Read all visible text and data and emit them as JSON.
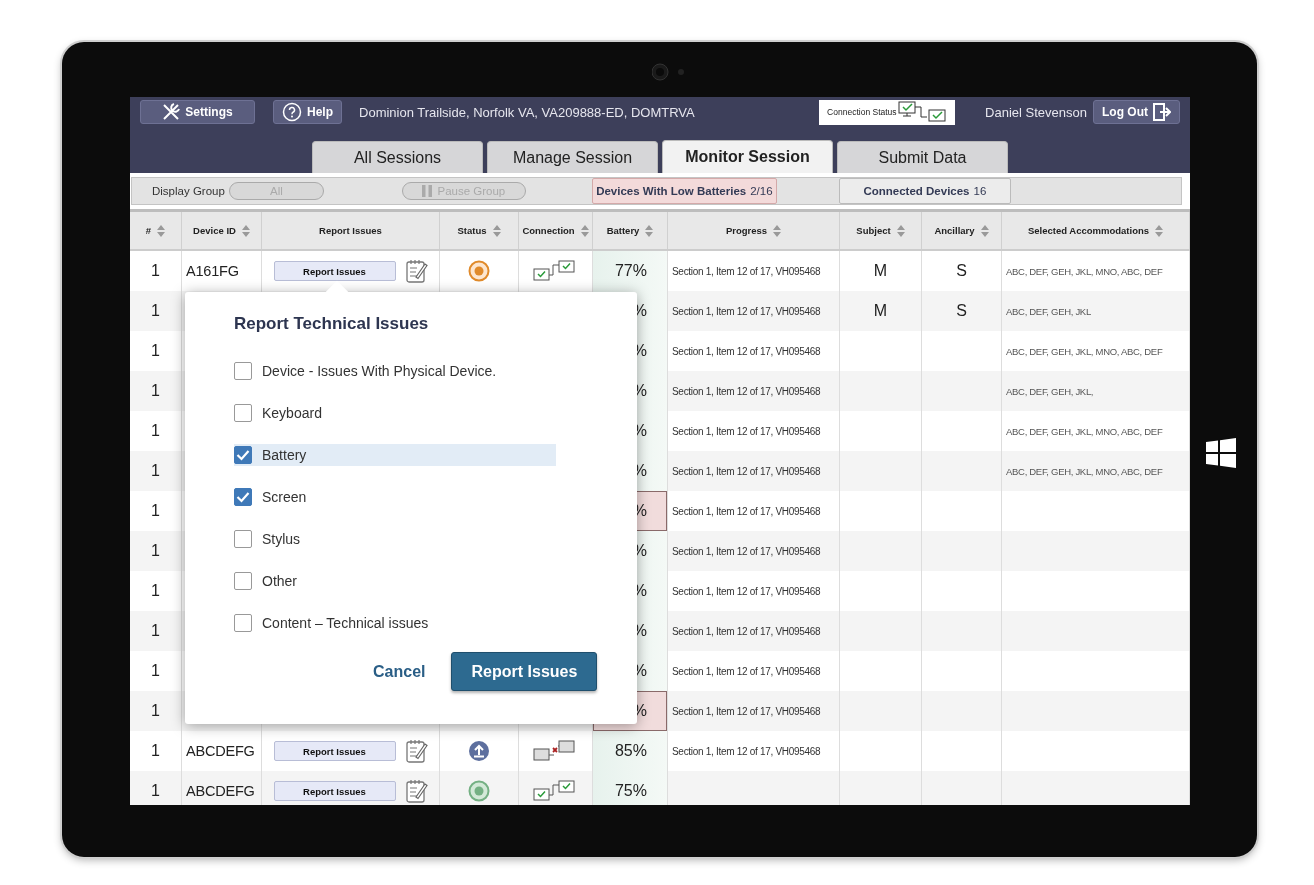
{
  "header": {
    "settings_button": "Settings",
    "help_button": "Help",
    "location": "Dominion Trailside, Norfolk VA, VA209888-ED, DOMTRVA",
    "connection_status": "Connection Status",
    "user": "Daniel Stevenson",
    "logout_button": "Log Out"
  },
  "tabs": [
    {
      "label": "All Sessions",
      "selected": false
    },
    {
      "label": "Manage Session",
      "selected": false
    },
    {
      "label": "Monitor Session",
      "selected": true
    },
    {
      "label": "Submit Data",
      "selected": false
    }
  ],
  "toolbar": {
    "display_group_label": "Display Group",
    "all_button": {
      "label": "All",
      "disabled": true
    },
    "pause_button": {
      "label": "Pause Group",
      "disabled": true
    },
    "low_batteries": {
      "label": "Devices With Low Batteries",
      "count": "2/16"
    },
    "connected": {
      "label": "Connected Devices",
      "count": "16"
    }
  },
  "columns": [
    {
      "label": "#",
      "sortable": true
    },
    {
      "label": "Device ID",
      "sortable": true
    },
    {
      "label": "Report Issues",
      "sortable": false
    },
    {
      "label": "Status",
      "sortable": true
    },
    {
      "label": "Connection",
      "sortable": true
    },
    {
      "label": "Battery",
      "sortable": true
    },
    {
      "label": "Progress",
      "sortable": true
    },
    {
      "label": "Subject",
      "sortable": true
    },
    {
      "label": "Ancillary",
      "sortable": true
    },
    {
      "label": "Selected Accommodations",
      "sortable": true
    }
  ],
  "rows": [
    {
      "number": "1",
      "device_id": "A161FG",
      "report_button": "Report Issues",
      "status": {
        "kind": "pending"
      },
      "connection": {
        "kind": "connected"
      },
      "battery": "77%",
      "battery_low": false,
      "progress": "Section 1, Item 12 of 17, VH095468",
      "subject": "M",
      "ancillary": "S",
      "accommodations": "ABC, DEF, GEH, JKL, MNO, ABC, DEF"
    },
    {
      "number": "1",
      "battery": "%",
      "battery_low": false,
      "progress": "Section 1, Item 12 of 17, VH095468",
      "subject": "M",
      "ancillary": "S",
      "accommodations": "ABC, DEF, GEH, JKL"
    },
    {
      "number": "1",
      "battery": "%",
      "battery_low": false,
      "progress": "Section 1, Item 12 of 17, VH095468",
      "accommodations": "ABC, DEF, GEH, JKL, MNO, ABC, DEF"
    },
    {
      "number": "1",
      "battery": "%",
      "battery_low": false,
      "progress": "Section 1, Item 12 of 17, VH095468",
      "accommodations": "ABC, DEF, GEH, JKL,"
    },
    {
      "number": "1",
      "battery": "%",
      "battery_low": false,
      "progress": "Section 1, Item 12 of 17, VH095468",
      "accommodations": "ABC, DEF, GEH, JKL, MNO, ABC, DEF"
    },
    {
      "number": "1",
      "battery": "%",
      "battery_low": false,
      "progress": "Section 1, Item 12 of 17, VH095468",
      "accommodations": "ABC, DEF, GEH, JKL, MNO, ABC, DEF"
    },
    {
      "number": "1",
      "battery": "%",
      "battery_low": true,
      "progress": "Section 1, Item 12 of 17, VH095468"
    },
    {
      "number": "1",
      "battery": "%",
      "battery_low": false,
      "progress": "Section 1, Item 12 of 17, VH095468"
    },
    {
      "number": "1",
      "battery": "%",
      "battery_low": false,
      "progress": "Section 1, Item 12 of 17, VH095468"
    },
    {
      "number": "1",
      "battery": "%",
      "battery_low": false,
      "progress": "Section 1, Item 12 of 17, VH095468"
    },
    {
      "number": "1",
      "battery": "%",
      "battery_low": false,
      "progress": "Section 1, Item 12 of 17, VH095468"
    },
    {
      "number": "1",
      "battery": "%",
      "battery_low": true,
      "progress": "Section 1, Item 12 of 17, VH095468"
    },
    {
      "number": "1",
      "device_id": "ABCDEFG",
      "report_button": "Report Issues",
      "status": {
        "kind": "upload"
      },
      "connection": {
        "kind": "disconnected"
      },
      "battery": "85%",
      "battery_low": false,
      "progress": "Section 1, Item 12 of 17, VH095468"
    },
    {
      "number": "1",
      "device_id": "ABCDEFG",
      "report_button": "Report Issues",
      "status": {
        "kind": "online"
      },
      "connection": {
        "kind": "connected"
      },
      "battery": "75%",
      "battery_low": false
    }
  ],
  "dialog": {
    "title": "Report Technical Issues",
    "options": [
      {
        "label": "Device - Issues With Physical Device.",
        "checked": false,
        "highlighted": false
      },
      {
        "label": "Keyboard",
        "checked": false,
        "highlighted": false
      },
      {
        "label": "Battery",
        "checked": true,
        "highlighted": true
      },
      {
        "label": "Screen",
        "checked": true,
        "highlighted": false
      },
      {
        "label": "Stylus",
        "checked": false,
        "highlighted": false
      },
      {
        "label": "Other",
        "checked": false,
        "highlighted": false
      },
      {
        "label": "Content – Technical issues",
        "checked": false,
        "highlighted": false
      }
    ],
    "cancel_button": "Cancel",
    "submit_button": "Report Issues"
  }
}
